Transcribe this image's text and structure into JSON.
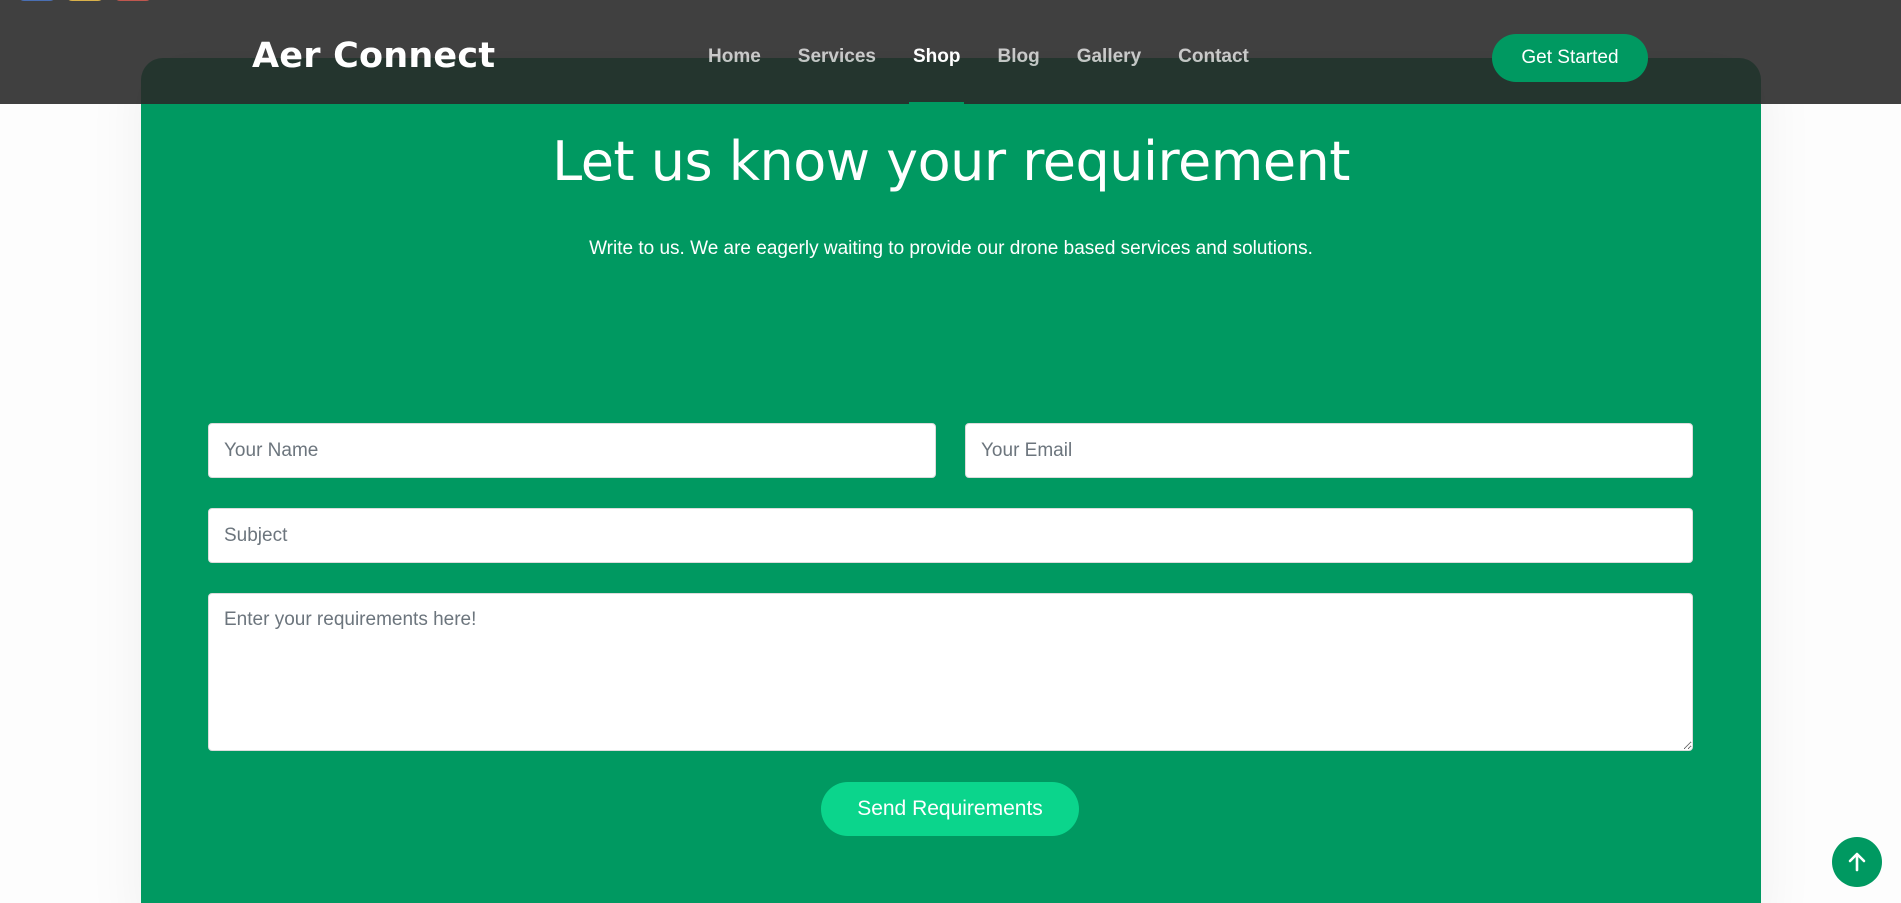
{
  "header": {
    "logo": "Aer Connect",
    "nav": [
      {
        "label": "Home"
      },
      {
        "label": "Services"
      },
      {
        "label": "Shop"
      },
      {
        "label": "Blog"
      },
      {
        "label": "Gallery"
      },
      {
        "label": "Contact"
      }
    ],
    "active_nav": "Shop",
    "cta_label": "Get Started"
  },
  "contact": {
    "title": "Let us know your requirement",
    "subtitle": "Write to us. We are eagerly waiting to provide our drone based services and solutions.",
    "name_placeholder": "Your Name",
    "email_placeholder": "Your Email",
    "subject_placeholder": "Subject",
    "message_placeholder": "Enter your requirements here!",
    "submit_label": "Send Requirements"
  },
  "colors": {
    "accent": "#009961",
    "button_bright": "#0bd58c",
    "header_bg": "#3a3a3a"
  },
  "icons": {
    "back_to_top": "arrow-up-icon"
  }
}
